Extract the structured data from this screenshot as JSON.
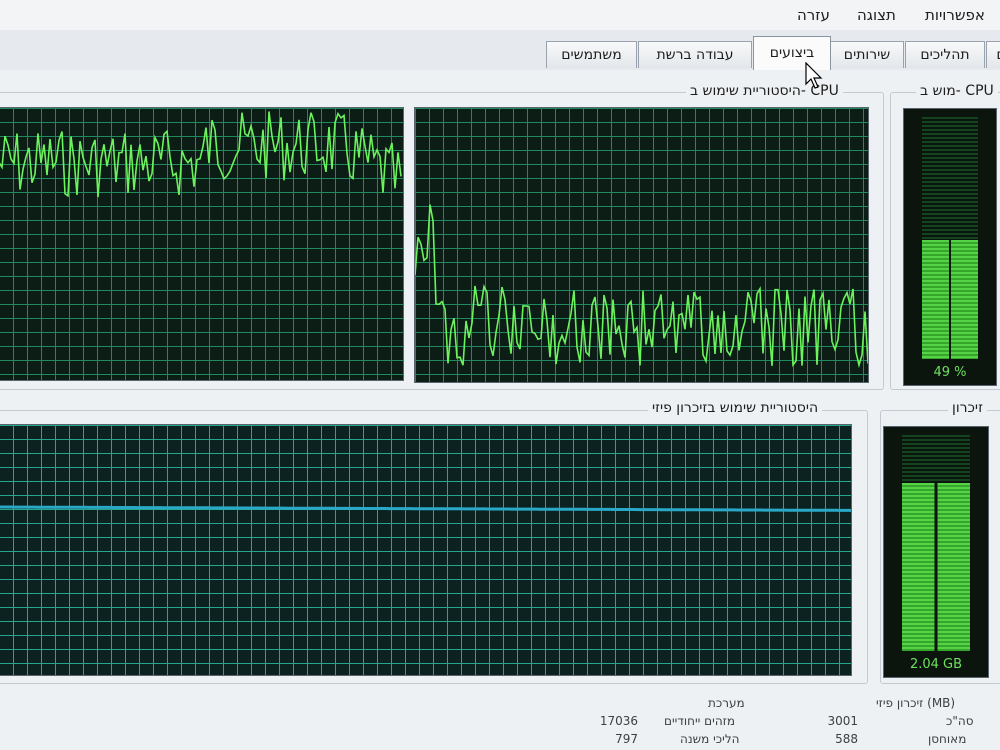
{
  "menu": {
    "options": "אפשרויות",
    "view": "תצוגה",
    "help": "עזרה"
  },
  "tabs": [
    {
      "label": "ם"
    },
    {
      "label": "תהליכים"
    },
    {
      "label": "שירותים"
    },
    {
      "label": "ביצועים",
      "active": true
    },
    {
      "label": "עבודה ברשת"
    },
    {
      "label": "משתמשים"
    }
  ],
  "cpu_usage": {
    "title": "מוש ב- CPU",
    "percent_label": "49 %",
    "level": 0.49
  },
  "cpu_history": {
    "title": "היסטוריית שימוש ב- CPU"
  },
  "memory": {
    "title": "זיכרון",
    "value_label": "2.04 GB",
    "level": 0.78
  },
  "memory_history": {
    "title": "היסטוריית שימוש בזיכרון פיזי"
  },
  "physical_memory": {
    "header": "זיכרון פיזי (MB)",
    "total_label": "סה\"כ",
    "total_value": "3001",
    "cached_label": "מאוחסן",
    "cached_value": "588"
  },
  "system": {
    "header": "מערכת",
    "handles_label": "מזהים ייחודיים",
    "handles_value": "17036",
    "threads_label": "הליכי משנה",
    "threads_value": "797"
  },
  "colors": {
    "cpu_line": "#6cf25c",
    "memory_line": "#2aa8c8"
  }
}
